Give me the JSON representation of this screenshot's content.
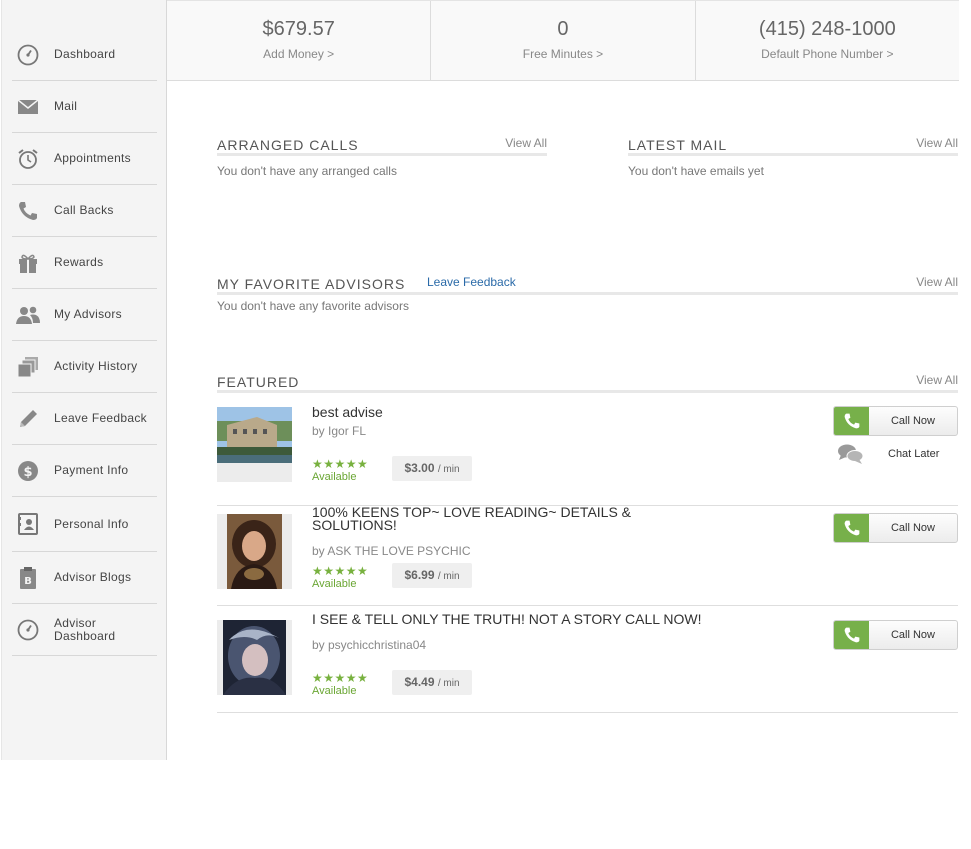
{
  "sidebar": {
    "items": [
      {
        "label": "Dashboard",
        "icon": "gauge-icon"
      },
      {
        "label": "Mail",
        "icon": "envelope-icon"
      },
      {
        "label": "Appointments",
        "icon": "alarm-clock-icon"
      },
      {
        "label": "Call Backs",
        "icon": "phone-icon"
      },
      {
        "label": "Rewards",
        "icon": "gift-icon"
      },
      {
        "label": "My Advisors",
        "icon": "people-icon"
      },
      {
        "label": "Activity History",
        "icon": "stack-icon"
      },
      {
        "label": "Leave Feedback",
        "icon": "pencil-icon"
      },
      {
        "label": "Payment Info",
        "icon": "dollar-icon"
      },
      {
        "label": "Personal Info",
        "icon": "id-card-icon"
      },
      {
        "label": "Advisor Blogs",
        "icon": "clipboard-icon"
      },
      {
        "label": "Advisor Dashboard",
        "icon": "gauge-icon"
      }
    ]
  },
  "stats": [
    {
      "value": "$679.57",
      "link": "Add Money >"
    },
    {
      "value": "0",
      "link": "Free Minutes >"
    },
    {
      "value": "(415) 248-1000",
      "link": "Default Phone Number >"
    }
  ],
  "arranged_calls": {
    "title": "ARRANGED CALLS",
    "view_all": "View All",
    "empty": "You don't have any arranged calls"
  },
  "latest_mail": {
    "title": "LATEST MAIL",
    "view_all": "View All",
    "empty": "You don't have emails yet"
  },
  "favorites": {
    "title": "MY FAVORITE ADVISORS",
    "leave_feedback": "Leave Feedback",
    "view_all": "View All",
    "empty": "You don't have any favorite advisors"
  },
  "featured": {
    "title": "FEATURED",
    "view_all": "View All",
    "items": [
      {
        "title": "best advise",
        "by": "by Igor FL",
        "stars": "★★★★★",
        "status": "Available",
        "price": "$3.00",
        "per": "/ min",
        "call": "Call Now",
        "chat": "Chat Later"
      },
      {
        "title": "100% KEENS TOP~ LOVE READING~ DETAILS & SOLUTIONS!",
        "by": "by ASK THE LOVE PSYCHIC",
        "stars": "★★★★★",
        "status": "Available",
        "price": "$6.99",
        "per": "/ min",
        "call": "Call Now"
      },
      {
        "title": "I SEE & TELL ONLY THE TRUTH! NOT A STORY CALL NOW!",
        "by": "by psychicchristina04",
        "stars": "★★★★★",
        "status": "Available",
        "price": "$4.49",
        "per": "/ min",
        "call": "Call Now"
      }
    ]
  },
  "colors": {
    "accent_green": "#77b04a",
    "link_blue": "#2a6aa8"
  }
}
